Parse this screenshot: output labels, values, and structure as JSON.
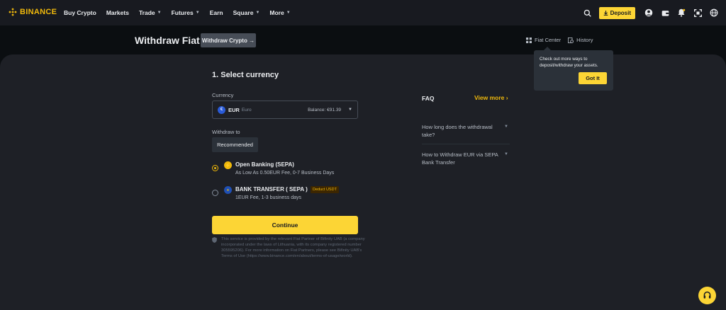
{
  "nav": {
    "logo": "BINANCE",
    "items": [
      {
        "label": "Buy Crypto",
        "caret": false
      },
      {
        "label": "Markets",
        "caret": false
      },
      {
        "label": "Trade",
        "caret": true
      },
      {
        "label": "Futures",
        "caret": true
      },
      {
        "label": "Earn",
        "caret": false
      },
      {
        "label": "Square",
        "caret": true
      },
      {
        "label": "More",
        "caret": true
      }
    ],
    "deposit_label": "Deposit",
    "icons": [
      "search-icon",
      "download-icon",
      "user-icon",
      "wallet-icon",
      "bell-icon",
      "qr-scan-icon",
      "globe-icon"
    ]
  },
  "header": {
    "title": "Withdraw Fiat",
    "withdraw_crypto_label": "Withdraw Crypto →",
    "fiat_center_label": "Fiat Center",
    "history_label": "History"
  },
  "tooltip": {
    "text": "Check out more ways to deposit/withdraw your assets.",
    "button_label": "Got It"
  },
  "form": {
    "step_title": "1. Select currency",
    "currency_label": "Currency",
    "currency": {
      "icon": "€",
      "code": "EUR",
      "name": "Euro",
      "balance": "Balance: €91.39"
    },
    "withdraw_to_label": "Withdraw to",
    "recommended_label": "Recommended",
    "methods": [
      {
        "title": "Open Banking (SEPA)",
        "subtitle": "As Low As 0.50EUR Fee, 0-7 Business Days",
        "selected": true,
        "icon": "lightning-icon"
      },
      {
        "title": "BANK TRANSFER ( SEPA )",
        "subtitle": "1EUR Fee, 1-3 business days",
        "selected": false,
        "badge": "Deduct USDT",
        "icon": "eu-flag-icon"
      }
    ],
    "continue_label": "Continue",
    "disclaimer": "This service is provided by the relevant Fiat Partner of Bifinity UAB (a company incorporated under the laws of Lithuania, with its company registered number 305595206). For more information on Fiat Partners, please see Bifinity UAB's Terms of Use (https://www.binance.com/en/about/terms-of-usage/world)."
  },
  "faq": {
    "title": "FAQ",
    "view_more": "View more ›",
    "items": [
      "How long does the withdrawal take?",
      "How to Withdraw EUR via SEPA Bank Transfer"
    ]
  },
  "colors": {
    "brand": "#f0b90b",
    "button": "#fcd535",
    "background": "#0b0e11",
    "panel": "#1e2026"
  }
}
